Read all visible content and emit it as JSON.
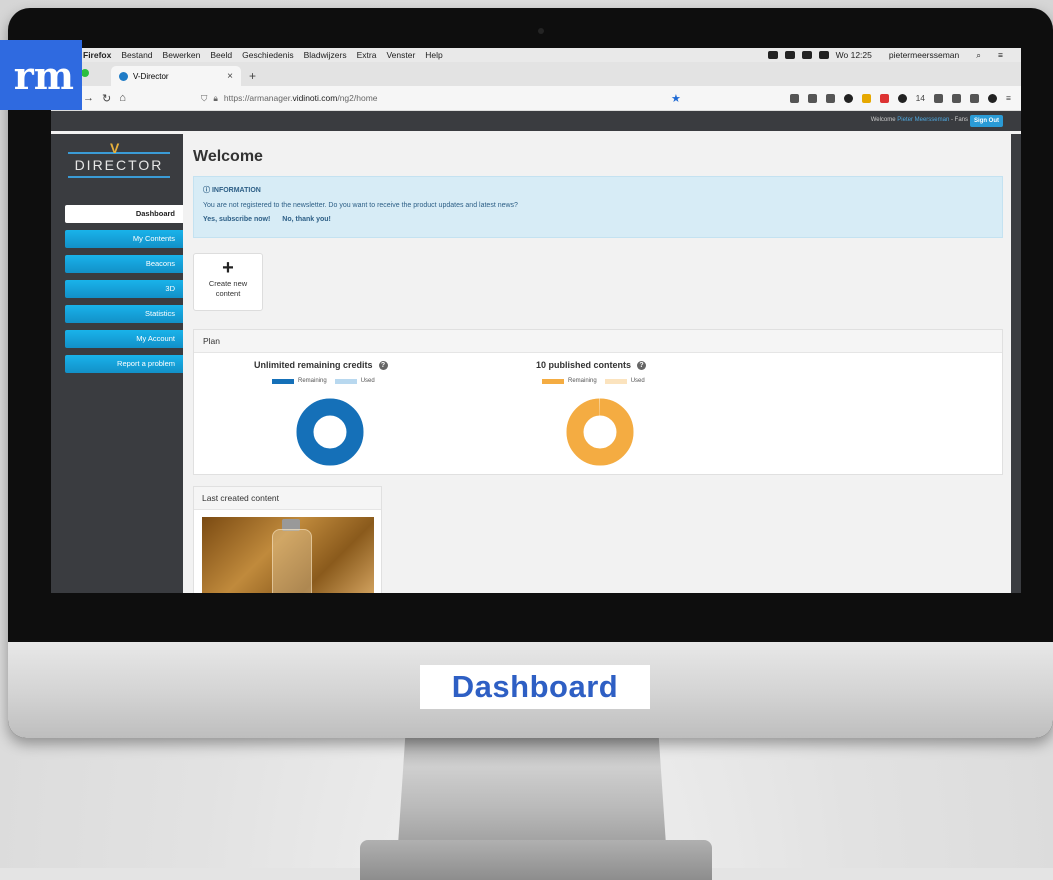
{
  "overlay": {
    "logo_text": "rm",
    "chin_label": "Dashboard"
  },
  "mac_menu": {
    "items": [
      "Firefox",
      "Bestand",
      "Bewerken",
      "Beeld",
      "Geschiedenis",
      "Bladwijzers",
      "Extra",
      "Venster",
      "Help"
    ],
    "clock": "Wo 12:25",
    "user": "pietermeersseman"
  },
  "browser": {
    "tab_title": "V-Director",
    "tab_close": "×",
    "new_tab": "+",
    "url_prefix": "https://armanager.",
    "url_domain": "vidinoti.com",
    "url_path": "/ng2/home",
    "ext_count": "14"
  },
  "appbar": {
    "welcome": "Welcome",
    "name": "Pieter Meersseman",
    "suffix": "- Fans",
    "sign_out": "Sign Out"
  },
  "brand": {
    "v": "V",
    "name": "DIRECTOR"
  },
  "sidebar": {
    "items": [
      {
        "label": "Dashboard",
        "active": true
      },
      {
        "label": "My Contents",
        "active": false
      },
      {
        "label": "Beacons",
        "active": false
      },
      {
        "label": "3D",
        "active": false
      },
      {
        "label": "Statistics",
        "active": false
      },
      {
        "label": "My Account",
        "active": false
      },
      {
        "label": "Report a problem",
        "active": false
      }
    ]
  },
  "main": {
    "title": "Welcome",
    "info": {
      "heading": "INFORMATION",
      "message": "You are not registered to the newsletter. Do you want to receive the product updates and latest news?",
      "yes": "Yes, subscribe now!",
      "no": "No, thank you!"
    },
    "create": {
      "plus": "+",
      "line1": "Create new",
      "line2": "content"
    },
    "plan": {
      "title": "Plan",
      "credits": {
        "title": "Unlimited remaining credits",
        "help": "?",
        "legend_remaining": "Remaining",
        "legend_used": "Used",
        "remaining_fraction": 1.0,
        "color_remaining": "#1570b8",
        "color_used": "#b8d8ef"
      },
      "published": {
        "title": "10 published contents",
        "help": "?",
        "legend_remaining": "Remaining",
        "legend_used": "Used",
        "remaining_fraction": 0.995,
        "color_remaining": "#f4ac42",
        "color_used": "#fbe3be"
      }
    },
    "last": {
      "title": "Last created content"
    }
  },
  "colors": {
    "sidebar": "#3a3c40",
    "accent": "#1aa9e0",
    "info_bg": "#d7ecf6"
  }
}
